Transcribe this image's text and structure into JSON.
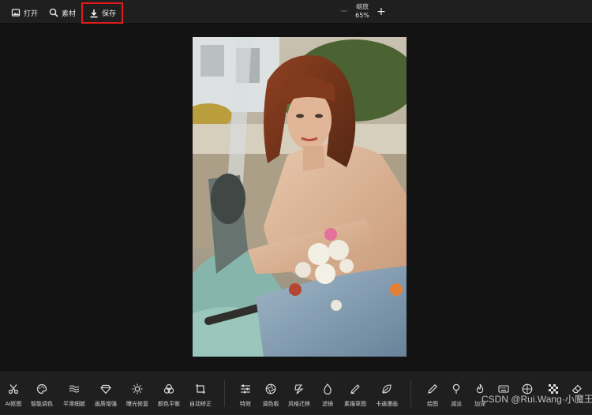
{
  "toolbar": {
    "open_label": "打开",
    "material_label": "素材",
    "save_label": "保存",
    "zoom_title": "缩放",
    "zoom_value": "65%",
    "zoom_minus": "−",
    "zoom_plus": "+"
  },
  "tools_left": [
    {
      "label": "AI抠图",
      "icon": "scissors-icon"
    },
    {
      "label": "智能调色",
      "icon": "palette-icon"
    },
    {
      "label": "平滑细腻",
      "icon": "waves-icon"
    },
    {
      "label": "画质增强",
      "icon": "diamond-icon"
    },
    {
      "label": "曝光修复",
      "icon": "sun-icon"
    },
    {
      "label": "颜色平衡",
      "icon": "circles-icon"
    },
    {
      "label": "自动矫正",
      "icon": "crop-icon"
    }
  ],
  "tools_mid": [
    {
      "label": "特效",
      "icon": "sliders-icon"
    },
    {
      "label": "调色板",
      "icon": "aperture-icon"
    },
    {
      "label": "风格迁移",
      "icon": "style-icon"
    },
    {
      "label": "滤镜",
      "icon": "drop-icon"
    },
    {
      "label": "素描草图",
      "icon": "pencil-sketch-icon"
    },
    {
      "label": "卡通漫画",
      "icon": "leaf-icon"
    }
  ],
  "tools_right": [
    {
      "label": "绘图",
      "icon": "pen-icon"
    },
    {
      "label": "减淡",
      "icon": "dodge-icon"
    },
    {
      "label": "加深",
      "icon": "flame-icon"
    },
    {
      "label": "",
      "icon": "keyboard-icon"
    },
    {
      "label": "",
      "icon": "grid-circle-icon"
    },
    {
      "label": "",
      "icon": "mosaic-icon"
    },
    {
      "label": "",
      "icon": "eraser-icon"
    }
  ],
  "watermark": "CSDN @Rui.Wang·小魔王",
  "colors": {
    "background": "#131313",
    "toolbar": "#1f1f1f",
    "highlight_border": "#e01b1b"
  }
}
